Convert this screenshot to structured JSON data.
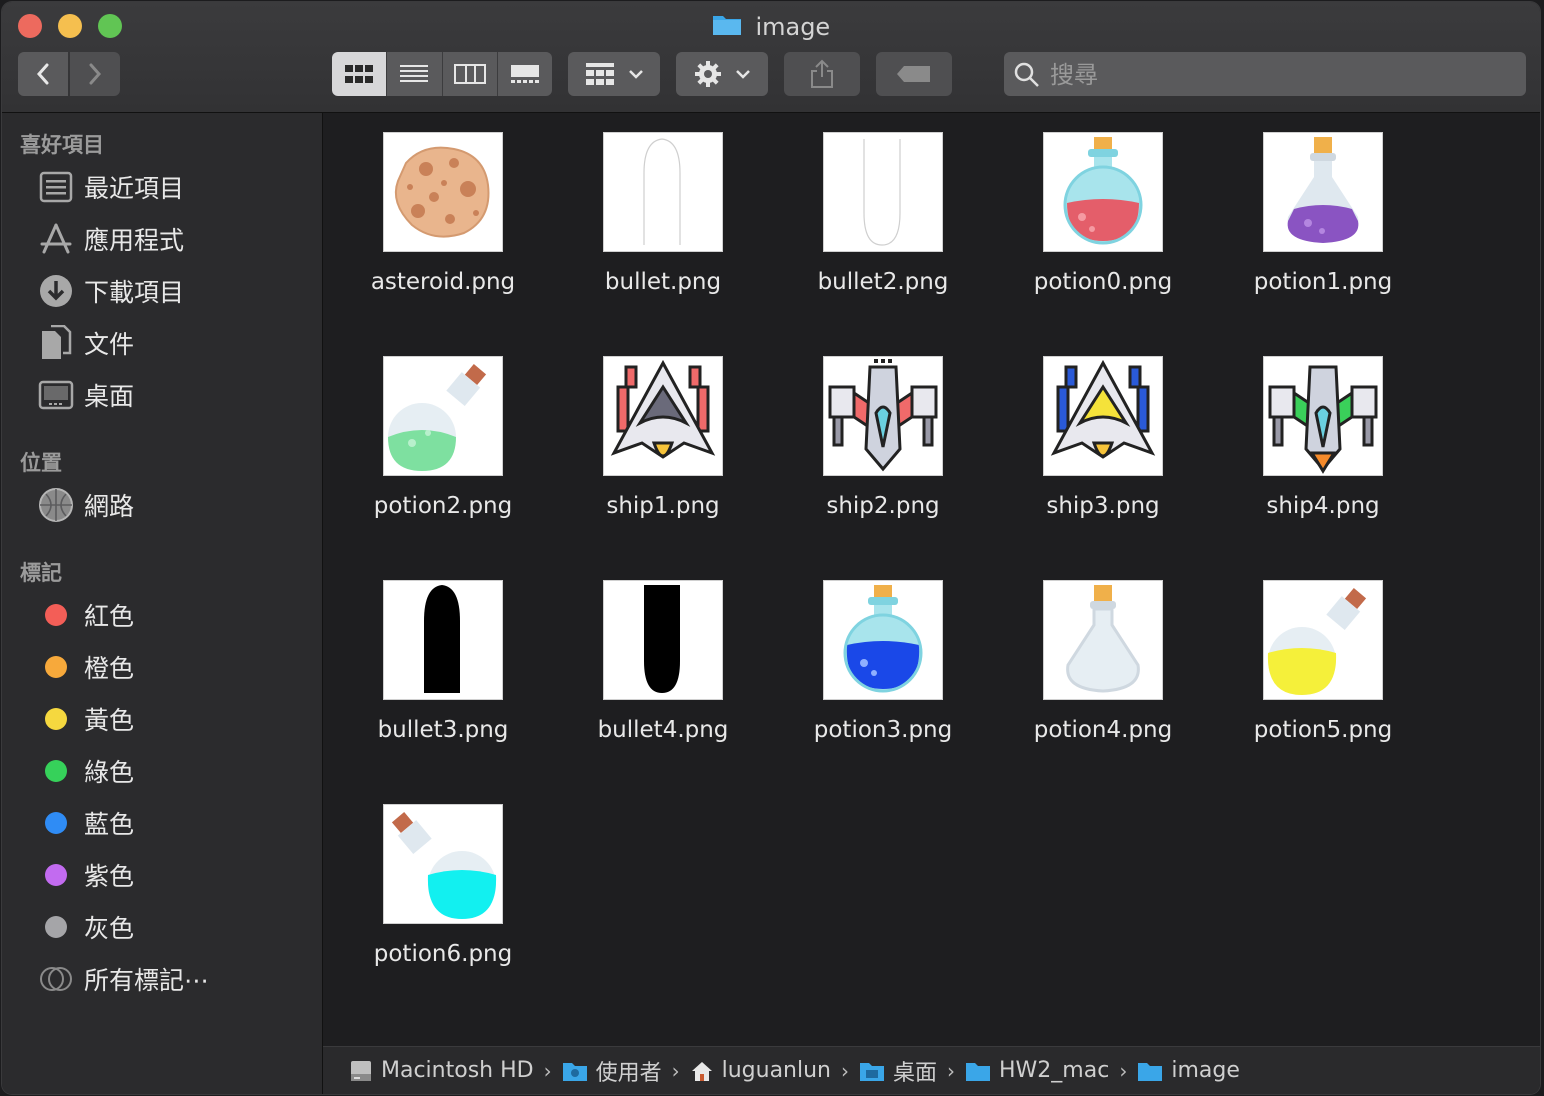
{
  "window": {
    "title": "image"
  },
  "toolbar": {
    "search_placeholder": "搜尋"
  },
  "sidebar": {
    "favorites_header": "喜好項目",
    "favorites": [
      {
        "label": "最近項目",
        "icon": "recents-icon"
      },
      {
        "label": "應用程式",
        "icon": "applications-icon"
      },
      {
        "label": "下載項目",
        "icon": "downloads-icon"
      },
      {
        "label": "文件",
        "icon": "documents-icon"
      },
      {
        "label": "桌面",
        "icon": "desktop-icon"
      }
    ],
    "locations_header": "位置",
    "locations": [
      {
        "label": "網路",
        "icon": "network-icon"
      }
    ],
    "tags_header": "標記",
    "tags": [
      {
        "label": "紅色",
        "color": "#f35e57"
      },
      {
        "label": "橙色",
        "color": "#f7a93b"
      },
      {
        "label": "黃色",
        "color": "#f5d83f"
      },
      {
        "label": "綠色",
        "color": "#36d15a"
      },
      {
        "label": "藍色",
        "color": "#2f8cf5"
      },
      {
        "label": "紫色",
        "color": "#c26bf0"
      },
      {
        "label": "灰色",
        "color": "#a5a5a8"
      }
    ],
    "all_tags": "所有標記⋯"
  },
  "files": [
    {
      "name": "asteroid.png"
    },
    {
      "name": "bullet.png"
    },
    {
      "name": "bullet2.png"
    },
    {
      "name": "potion0.png"
    },
    {
      "name": "potion1.png"
    },
    {
      "name": "potion2.png"
    },
    {
      "name": "ship1.png"
    },
    {
      "name": "ship2.png"
    },
    {
      "name": "ship3.png"
    },
    {
      "name": "ship4.png"
    },
    {
      "name": "bullet3.png"
    },
    {
      "name": "bullet4.png"
    },
    {
      "name": "potion3.png"
    },
    {
      "name": "potion4.png"
    },
    {
      "name": "potion5.png"
    },
    {
      "name": "potion6.png"
    }
  ],
  "pathbar": {
    "crumbs": [
      "Macintosh HD",
      "使用者",
      "luguanlun",
      "桌面",
      "HW2_mac",
      "image"
    ]
  }
}
